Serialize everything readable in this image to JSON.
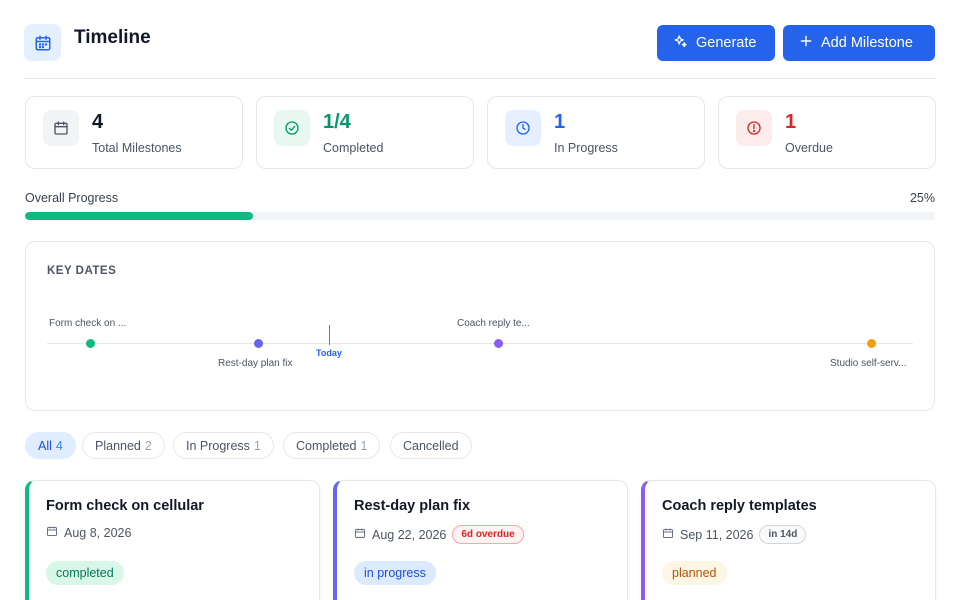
{
  "header": {
    "title": "Timeline",
    "title_icon": "calendar-icon",
    "generate_label": "Generate",
    "generate_icon": "sparkles-icon",
    "add_label": "Add Milestone",
    "add_icon": "plus-icon",
    "accent_color": "#2563eb"
  },
  "stats": [
    {
      "value": "4",
      "label": "Total Milestones",
      "icon": "calendar-icon",
      "color": "#111827"
    },
    {
      "value": "1/4",
      "label": "Completed",
      "icon": "check-circle-icon",
      "color": "#059669"
    },
    {
      "value": "1",
      "label": "In Progress",
      "icon": "clock-icon",
      "color": "#2563eb"
    },
    {
      "value": "1",
      "label": "Overdue",
      "icon": "alert-circle-icon",
      "color": "#dc2626"
    }
  ],
  "progress": {
    "label": "Overall Progress",
    "percent_text": "25%",
    "fraction": 0.25,
    "color": "#10b981"
  },
  "key_dates": {
    "title": "KEY DATES",
    "today_label": "Today",
    "items": [
      {
        "label": "Form check on ...",
        "color": "#10b981"
      },
      {
        "label": "Rest-day plan fix",
        "color": "#6366f1"
      },
      {
        "label": "Coach reply te...",
        "color": "#8b5cf6"
      },
      {
        "label": "Studio self-serv...",
        "color": "#f59e0b"
      }
    ]
  },
  "filters": [
    {
      "label": "All",
      "count": "4",
      "active": true
    },
    {
      "label": "Planned",
      "count": "2",
      "active": false
    },
    {
      "label": "In Progress",
      "count": "1",
      "active": false
    },
    {
      "label": "Completed",
      "count": "1",
      "active": false
    },
    {
      "label": "Cancelled",
      "count": "",
      "active": false
    }
  ],
  "milestones": [
    {
      "title": "Form check on cellular",
      "date": "Aug 8, 2026",
      "flag": "",
      "status": "completed",
      "border_color": "#10b981"
    },
    {
      "title": "Rest-day plan fix",
      "date": "Aug 22, 2026",
      "flag": "6d overdue",
      "status": "in progress",
      "border_color": "#6366f1"
    },
    {
      "title": "Coach reply templates",
      "date": "Sep 11, 2026",
      "flag": "in 14d",
      "status": "planned",
      "border_color": "#8b5cf6"
    }
  ]
}
